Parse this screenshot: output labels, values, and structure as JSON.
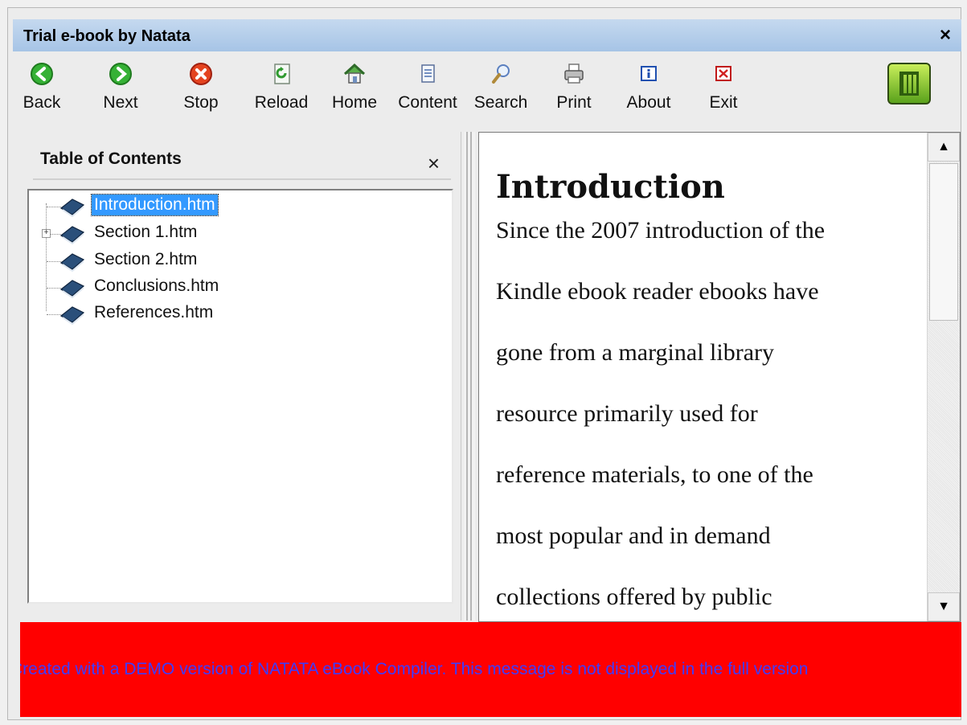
{
  "window": {
    "title": "Trial e-book by Natata",
    "close_glyph": "×"
  },
  "toolbar": {
    "buttons": [
      {
        "label": "Back",
        "icon": "back-icon",
        "color": "#2fa82f"
      },
      {
        "label": "Next",
        "icon": "next-icon",
        "color": "#2fa82f"
      },
      {
        "label": "Stop",
        "icon": "stop-icon",
        "color": "#e04020"
      },
      {
        "label": "Reload",
        "icon": "reload-icon",
        "color": "#2f8f2f"
      },
      {
        "label": "Home",
        "icon": "home-icon",
        "color": "#3a7a2a"
      },
      {
        "label": "Content",
        "icon": "content-icon",
        "color": "#4a6fb0"
      },
      {
        "label": "Search",
        "icon": "search-icon",
        "color": "#6a8fbf"
      },
      {
        "label": "Print",
        "icon": "print-icon",
        "color": "#555555"
      },
      {
        "label": "About",
        "icon": "about-icon",
        "color": "#2050b0"
      },
      {
        "label": "Exit",
        "icon": "exit-icon",
        "color": "#d02020"
      }
    ],
    "logo_icon": "natata-logo-icon"
  },
  "toc": {
    "title": "Table of Contents",
    "close_glyph": "×",
    "items": [
      {
        "label": "Introduction.htm",
        "selected": true,
        "expandable": false
      },
      {
        "label": "Section 1.htm",
        "selected": false,
        "expandable": true
      },
      {
        "label": "Section 2.htm",
        "selected": false,
        "expandable": false
      },
      {
        "label": "Conclusions.htm",
        "selected": false,
        "expandable": false
      },
      {
        "label": "References.htm",
        "selected": false,
        "expandable": false
      }
    ]
  },
  "content": {
    "heading": "Introduction",
    "lines": [
      "Since the 2007 introduction of the",
      "Kindle ebook reader ebooks have",
      "gone from a marginal library",
      "resource primarily used for",
      "reference materials, to one of the",
      "most popular and in demand",
      "collections offered by public"
    ]
  },
  "scrollbar": {
    "up_glyph": "▲",
    "down_glyph": "▼"
  },
  "banner": {
    "text": "Created with a DEMO version of NATATA eBook Compiler. This message is not displayed in the full version",
    "background": "#ff0000",
    "text_color": "#3d3dff"
  }
}
